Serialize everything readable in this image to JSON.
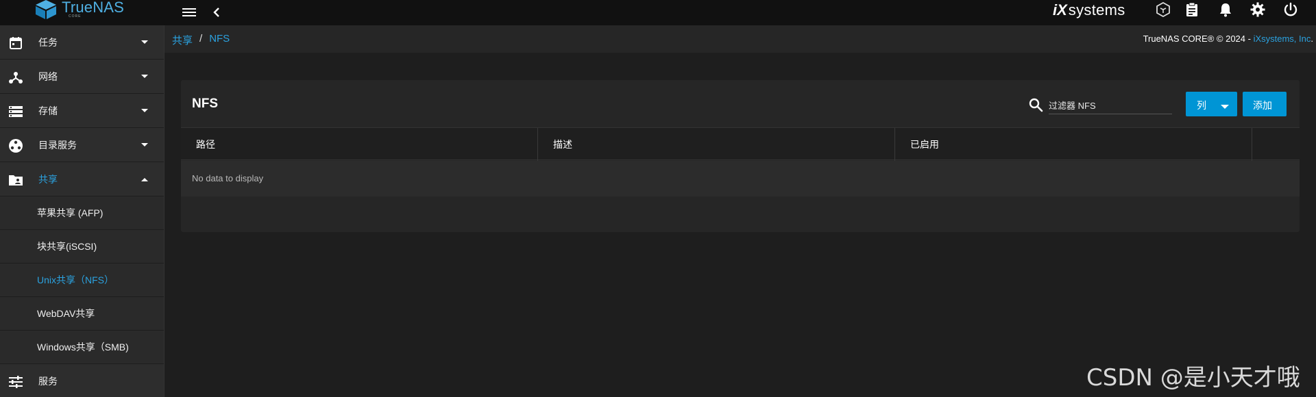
{
  "brand": {
    "name": "TrueNAS",
    "sub": "CORE"
  },
  "vendor_logo": {
    "mark": "iX",
    "text": "systems"
  },
  "topbar": {
    "icons": [
      "menu-icon",
      "back-icon",
      "truecommand-icon",
      "tasks-icon",
      "bell-icon",
      "gear-icon",
      "power-icon"
    ]
  },
  "sidebar": {
    "items": [
      {
        "label": "任务",
        "icon": "calendar-icon",
        "expanded": false
      },
      {
        "label": "网络",
        "icon": "network-icon",
        "expanded": false
      },
      {
        "label": "存储",
        "icon": "storage-icon",
        "expanded": false
      },
      {
        "label": "目录服务",
        "icon": "directory-icon",
        "expanded": false
      },
      {
        "label": "共享",
        "icon": "folder-share-icon",
        "expanded": true
      },
      {
        "label": "服务",
        "icon": "tune-icon",
        "expanded": false
      }
    ],
    "sub_items": [
      {
        "label": "苹果共享 (AFP)"
      },
      {
        "label": "块共享(iSCSI)"
      },
      {
        "label": "Unix共享（NFS）",
        "active": true
      },
      {
        "label": "WebDAV共享"
      },
      {
        "label": "Windows共享（SMB)"
      }
    ]
  },
  "breadcrumb": {
    "root": "共享",
    "sep": "/",
    "current": "NFS"
  },
  "copyright": {
    "text": "TrueNAS CORE® © 2024 - ",
    "link": "iXsystems, Inc",
    "end": "."
  },
  "card": {
    "title": "NFS",
    "filter_placeholder": "过滤器 NFS",
    "columns_button": "列",
    "add_button": "添加",
    "columns": [
      "路径",
      "描述",
      "已启用"
    ],
    "empty_text": "No data to display"
  },
  "watermark": "CSDN @是小天才哦",
  "colors": {
    "accent": "#2ba2e0",
    "button": "#0095d5",
    "brand": "#4fb0e3"
  }
}
